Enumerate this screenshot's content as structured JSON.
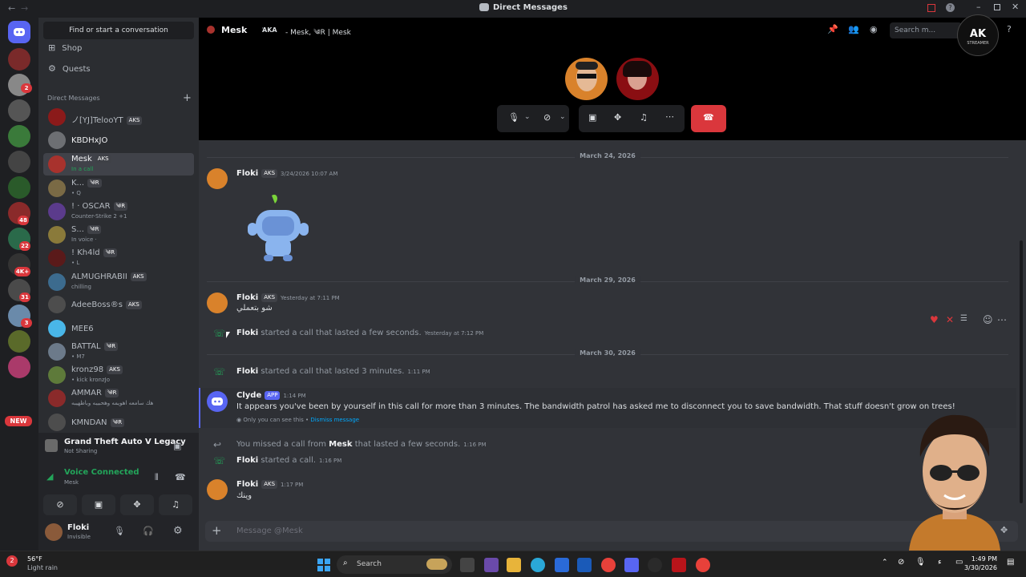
{
  "window": {
    "title": "Direct Messages"
  },
  "search": {
    "placeholder": "Find or start a conversation"
  },
  "nav": {
    "shop": "Shop",
    "quests": "Quests",
    "dm_header": "Direct Messages"
  },
  "guild_badges": [
    "2",
    "48",
    "22",
    "4K+",
    "31",
    "3",
    "NEW"
  ],
  "dms": [
    {
      "name": "ノ[YJ]TelooYT",
      "tag": "AKS",
      "status": "",
      "color": "#8b1a1a"
    },
    {
      "name": "KBDHxJO",
      "tag": "",
      "status": "",
      "color": "#6d6f73"
    },
    {
      "name": "Mesk",
      "tag": "AKS",
      "status": "In a call",
      "color": "#a8322d"
    },
    {
      "name": "K...",
      "tag": "༄R",
      "status": "• Q",
      "color": "#7a6a45"
    },
    {
      "name": "! · OSCAR",
      "tag": "༄R",
      "status": "Counter-Strike 2 +1",
      "color": "#5b3b8c"
    },
    {
      "name": "S...",
      "tag": "༄R",
      "status": "In voice ·",
      "color": "#8a7a3a"
    },
    {
      "name": "! Kh4ld",
      "tag": "༄R",
      "status": "• L",
      "color": "#5a1a1a"
    },
    {
      "name": "ALMUGHRABII",
      "tag": "AKS",
      "status": "chilling",
      "color": "#3c6b8e"
    },
    {
      "name": "AdeeBoss®ѕ",
      "tag": "AKS",
      "status": "",
      "color": "#4d4d4d"
    },
    {
      "name": "MEE6",
      "tag": "",
      "status": "",
      "color": "#49b6e8"
    },
    {
      "name": "BATTAL",
      "tag": "༄R",
      "status": "• M7",
      "color": "#6c7a8a"
    },
    {
      "name": "kronz98",
      "tag": "AKS",
      "status": "• kick kronzJo",
      "color": "#5e7a3a"
    },
    {
      "name": "AMMAR",
      "tag": "༄R",
      "status": "هك سامعه اهويمه وهحبيبه وباظهيبه",
      "color": "#8a2a2a"
    },
    {
      "name": "KMNDAN",
      "tag": "༄R",
      "status": "",
      "color": "#4d4d4d"
    }
  ],
  "activity": {
    "game": "Grand Theft Auto V Legacy",
    "sub": "Not Sharing"
  },
  "voice": {
    "status": "Voice Connected",
    "channel": "Mesk"
  },
  "user": {
    "name": "Floki",
    "status": "Invisible"
  },
  "header": {
    "name": "Mesk",
    "aka": "AKA",
    "aka_names": "- Mesk, ༄R | Mesk",
    "search_placeholder": "Search m..."
  },
  "dates": {
    "d1": "March 24, 2026",
    "d2": "March 29, 2026",
    "d3": "March 30, 2026"
  },
  "messages": {
    "m1_author": "Floki",
    "m1_tag": "AKS",
    "m1_time": "3/24/2026 10:07 AM",
    "m2_author": "Floki",
    "m2_tag": "AKS",
    "m2_time": "Yesterday at 7:11 PM",
    "m2_text": "شو بتعملي",
    "s1_author": "Floki",
    "s1_text": "started a call that lasted a few seconds.",
    "s1_time": "Yesterday at 7:12 PM",
    "s2_author": "Floki",
    "s2_text": "started a call that lasted 3 minutes.",
    "s2_time": "1:11 PM",
    "c_author": "Clyde",
    "c_tag": "APP",
    "c_time": "1:14 PM",
    "c_text": "It appears you've been by yourself in this call for more than 3 minutes. The bandwidth patrol has asked me to disconnect you to save bandwidth. That stuff doesn't grow on trees!",
    "c_note": "Only you can see this •",
    "c_dismiss": "Dismiss message",
    "s3_pre": "You missed a call from",
    "s3_author": "Mesk",
    "s3_text": "that lasted a few seconds.",
    "s3_time": "1:16 PM",
    "s4_author": "Floki",
    "s4_text": "started a call.",
    "s4_time": "1:16 PM",
    "m3_author": "Floki",
    "m3_tag": "AKS",
    "m3_time": "1:17 PM",
    "m3_text": "وينك"
  },
  "composer": {
    "placeholder": "Message @Mesk"
  },
  "logo": {
    "text": "AK",
    "sub": "STREAMER"
  },
  "taskbar": {
    "weather_temp": "56°F",
    "weather_desc": "Light rain",
    "search": "Search",
    "time": "1:49 PM",
    "date": "3/30/2026"
  },
  "colors": {
    "accent": "#5865f2",
    "danger": "#da373c",
    "green": "#23a55a"
  }
}
